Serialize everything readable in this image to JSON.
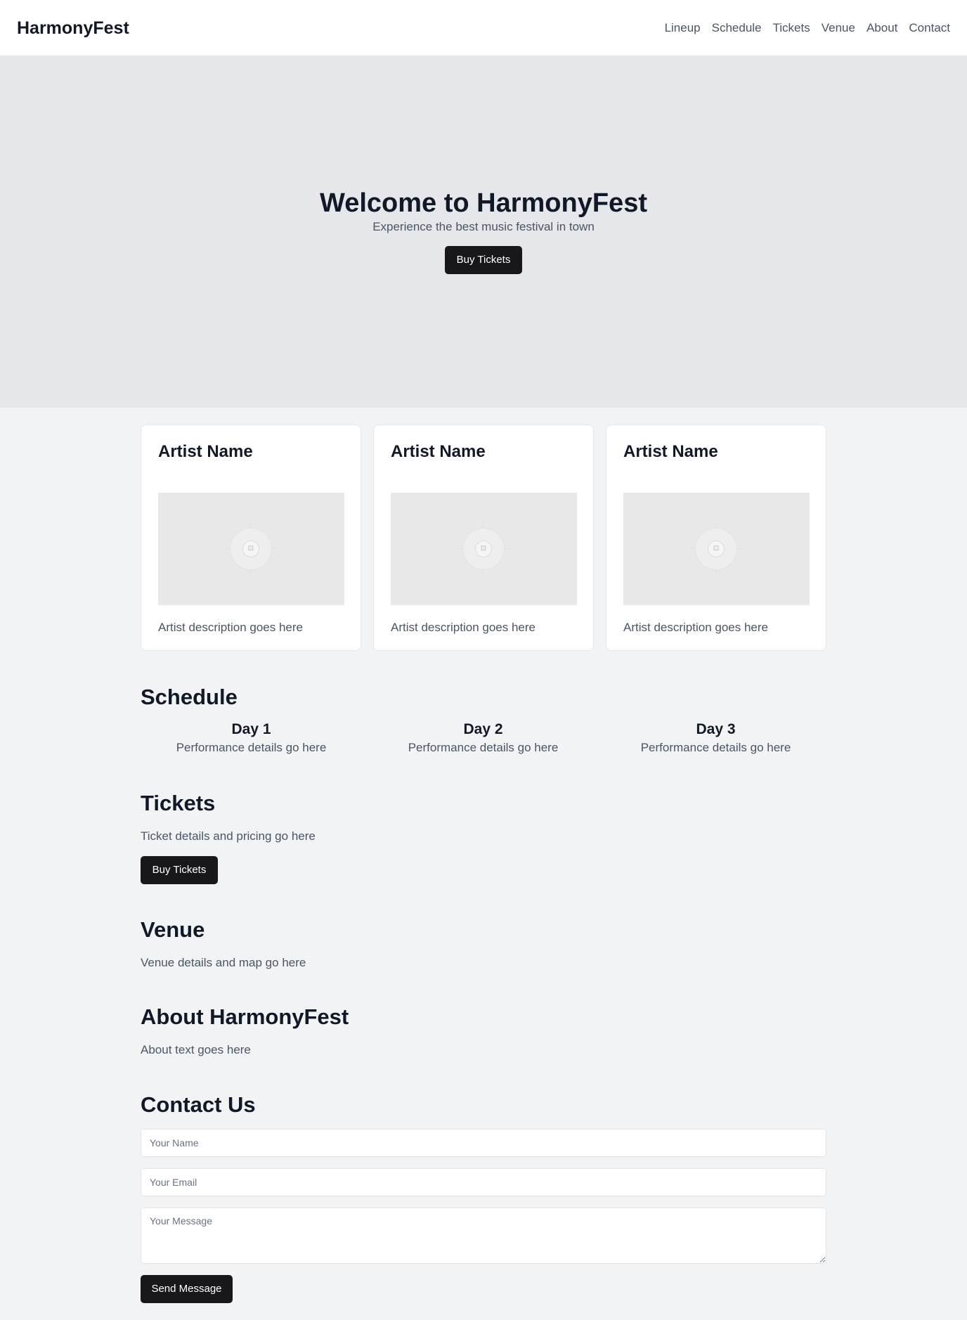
{
  "header": {
    "brand": "HarmonyFest",
    "nav": [
      "Lineup",
      "Schedule",
      "Tickets",
      "Venue",
      "About",
      "Contact"
    ]
  },
  "hero": {
    "title": "Welcome to HarmonyFest",
    "subtitle": "Experience the best music festival in town",
    "button": "Buy Tickets"
  },
  "lineup": {
    "artists": [
      {
        "name": "Artist Name",
        "description": "Artist description goes here",
        "image_icon": "image-placeholder-icon"
      },
      {
        "name": "Artist Name",
        "description": "Artist description goes here",
        "image_icon": "image-placeholder-icon"
      },
      {
        "name": "Artist Name",
        "description": "Artist description goes here",
        "image_icon": "image-placeholder-icon"
      }
    ]
  },
  "schedule": {
    "heading": "Schedule",
    "days": [
      {
        "title": "Day 1",
        "text": "Performance details go here"
      },
      {
        "title": "Day 2",
        "text": "Performance details go here"
      },
      {
        "title": "Day 3",
        "text": "Performance details go here"
      }
    ]
  },
  "tickets": {
    "heading": "Tickets",
    "text": "Ticket details and pricing go here",
    "button": "Buy Tickets"
  },
  "venue": {
    "heading": "Venue",
    "text": "Venue details and map go here"
  },
  "about": {
    "heading": "About HarmonyFest",
    "text": "About text goes here"
  },
  "contact": {
    "heading": "Contact Us",
    "name_placeholder": "Your Name",
    "email_placeholder": "Your Email",
    "message_placeholder": "Your Message",
    "button": "Send Message"
  },
  "colors": {
    "page_bg": "#f2f3f5",
    "hero_bg": "#e5e7ea",
    "button_bg": "#18181b",
    "heading": "#111827",
    "body_text": "#4b5563"
  }
}
